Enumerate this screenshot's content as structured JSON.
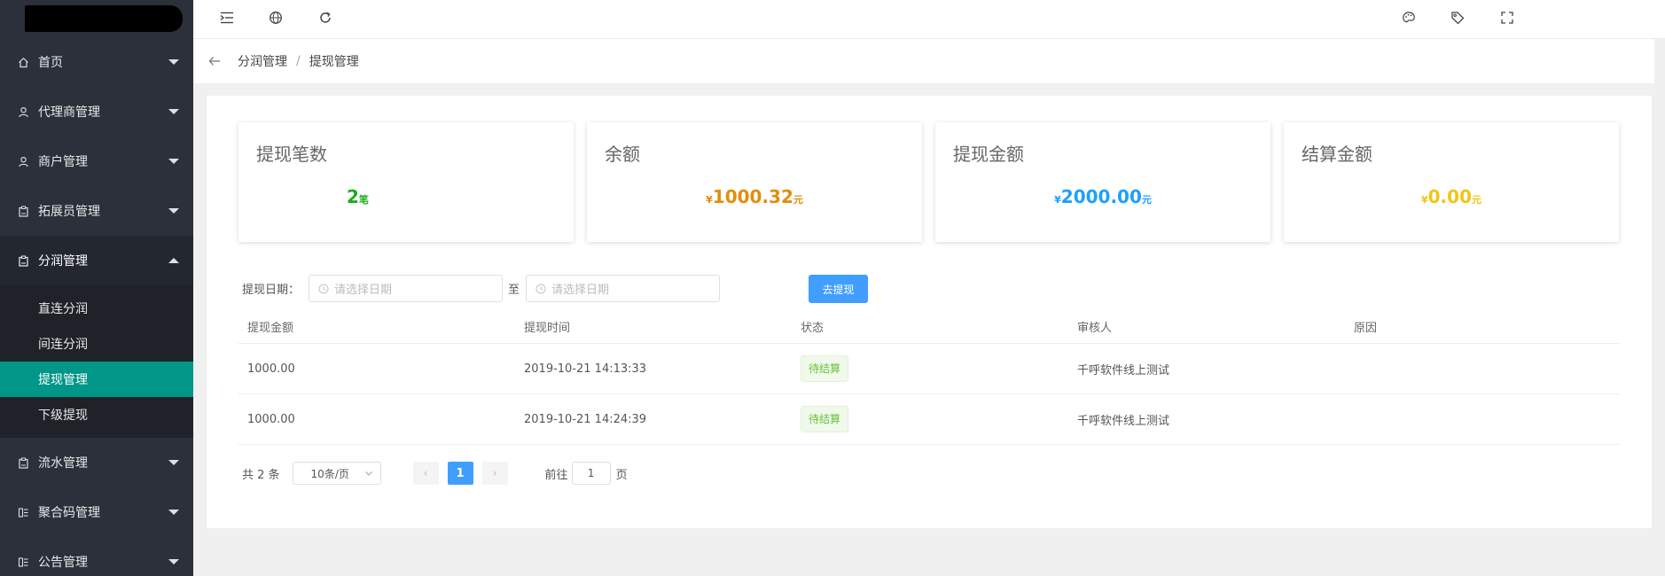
{
  "sidebar": {
    "items": [
      {
        "label": "首页",
        "icon": "home-icon"
      },
      {
        "label": "代理商管理",
        "icon": "user-icon"
      },
      {
        "label": "商户管理",
        "icon": "user-icon"
      },
      {
        "label": "拓展员管理",
        "icon": "clipboard-icon"
      },
      {
        "label": "分润管理",
        "icon": "clipboard-icon"
      },
      {
        "label": "流水管理",
        "icon": "clipboard-icon"
      },
      {
        "label": "聚合码管理",
        "icon": "qrcode-icon"
      },
      {
        "label": "公告管理",
        "icon": "qrcode-icon"
      }
    ],
    "submenu": [
      {
        "label": "直连分润"
      },
      {
        "label": "间连分润"
      },
      {
        "label": "提现管理"
      },
      {
        "label": "下级提现"
      }
    ]
  },
  "breadcrumb": {
    "first": "分润管理",
    "separator": "/",
    "second": "提现管理"
  },
  "cards": [
    {
      "title": "提现笔数",
      "prefix": "",
      "value": "2",
      "suffix": "笔",
      "color": "#1aad19"
    },
    {
      "title": "余额",
      "prefix": "¥",
      "value": "1000.32",
      "suffix": "元",
      "color": "#e08e0b"
    },
    {
      "title": "提现金额",
      "prefix": "¥",
      "value": "2000.00",
      "suffix": "元",
      "color": "#1e9fff"
    },
    {
      "title": "结算金额",
      "prefix": "¥",
      "value": "0.00",
      "suffix": "元",
      "color": "#f0c419"
    }
  ],
  "filter": {
    "label": "提现日期：",
    "start_placeholder": "请选择日期",
    "to": "至",
    "end_placeholder": "请选择日期",
    "button": "去提现"
  },
  "table": {
    "headers": [
      "提现金额",
      "提现时间",
      "状态",
      "审核人",
      "原因"
    ],
    "rows": [
      {
        "amount": "1000.00",
        "time": "2019-10-21 14:13:33",
        "status": "待结算",
        "auditor": "千呼软件线上测试",
        "reason": ""
      },
      {
        "amount": "1000.00",
        "time": "2019-10-21 14:24:39",
        "status": "待结算",
        "auditor": "千呼软件线上测试",
        "reason": ""
      }
    ]
  },
  "pagination": {
    "total": "共 2 条",
    "page_size": "10条/页",
    "prev": "‹",
    "current": "1",
    "next": "›",
    "goto_label": "前往",
    "goto_value": "1",
    "page_unit": "页"
  },
  "colors": {
    "sidebar_bg": "#2b303b",
    "active": "#009688",
    "primary": "#409eff"
  }
}
